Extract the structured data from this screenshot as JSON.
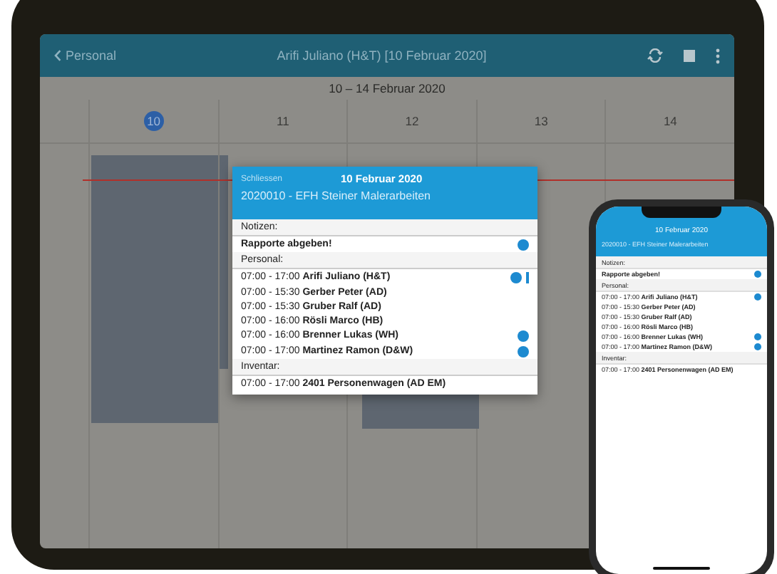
{
  "ipad": {
    "nav": {
      "back": "Personal",
      "title": "Arifi Juliano (H&T) [10 Februar 2020]"
    },
    "week_title": "10 – 14 Februar 2020",
    "days": [
      {
        "number": "10",
        "selected": true
      },
      {
        "number": "11",
        "selected": false
      },
      {
        "number": "12",
        "selected": false
      },
      {
        "number": "13",
        "selected": false
      },
      {
        "number": "14",
        "selected": false
      }
    ],
    "popup": {
      "close": "Schliessen",
      "date": "10 Februar 2020",
      "job": "2020010 - EFH Steiner Malerarbeiten",
      "sections": [
        {
          "heading": "Notizen:",
          "rows": [
            {
              "time": "",
              "text": "Rapporte abgeben!",
              "info": true,
              "more": false
            }
          ]
        },
        {
          "heading": "Personal:",
          "rows": [
            {
              "time": "07:00 - 17:00",
              "text": "Arifi Juliano (H&T)",
              "info": true,
              "more": true
            },
            {
              "time": "07:00 - 15:30",
              "text": "Gerber Peter (AD)",
              "info": false,
              "more": false
            },
            {
              "time": "07:00 - 15:30",
              "text": "Gruber Ralf (AD)",
              "info": false,
              "more": false
            },
            {
              "time": "07:00 - 16:00",
              "text": "Rösli Marco (HB)",
              "info": false,
              "more": false
            },
            {
              "time": "07:00 - 16:00",
              "text": "Brenner Lukas (WH)",
              "info": true,
              "more": false
            },
            {
              "time": "07:00 - 17:00",
              "text": "Martinez Ramon (D&W)",
              "info": true,
              "more": false
            }
          ]
        },
        {
          "heading": "Inventar:",
          "rows": [
            {
              "time": "07:00 - 17:00",
              "text": "2401 Personenwagen (AD EM)",
              "info": false,
              "more": false
            }
          ]
        }
      ]
    }
  },
  "phone": {
    "date": "10 Februar 2020",
    "job": "2020010 - EFH Steiner Malerarbeiten",
    "sections": [
      {
        "heading": "Notizen:",
        "rows": [
          {
            "time": "",
            "text": "Rapporte abgeben!",
            "info": true
          }
        ]
      },
      {
        "heading": "Personal:",
        "rows": [
          {
            "time": "07:00 - 17:00",
            "text": "Arifi Juliano (H&T)",
            "info": true
          },
          {
            "time": "07:00 - 15:30",
            "text": "Gerber Peter (AD)",
            "info": false
          },
          {
            "time": "07:00 - 15:30",
            "text": "Gruber Ralf (AD)",
            "info": false
          },
          {
            "time": "07:00 - 16:00",
            "text": "Rösli Marco (HB)",
            "info": false
          },
          {
            "time": "07:00 - 16:00",
            "text": "Brenner Lukas (WH)",
            "info": true
          },
          {
            "time": "07:00 - 17:00",
            "text": "Martinez Ramon (D&W)",
            "info": true
          }
        ]
      },
      {
        "heading": "Inventar:",
        "rows": [
          {
            "time": "07:00 - 17:00",
            "text": "2401 Personenwagen (AD EM)",
            "info": false
          }
        ]
      }
    ]
  }
}
